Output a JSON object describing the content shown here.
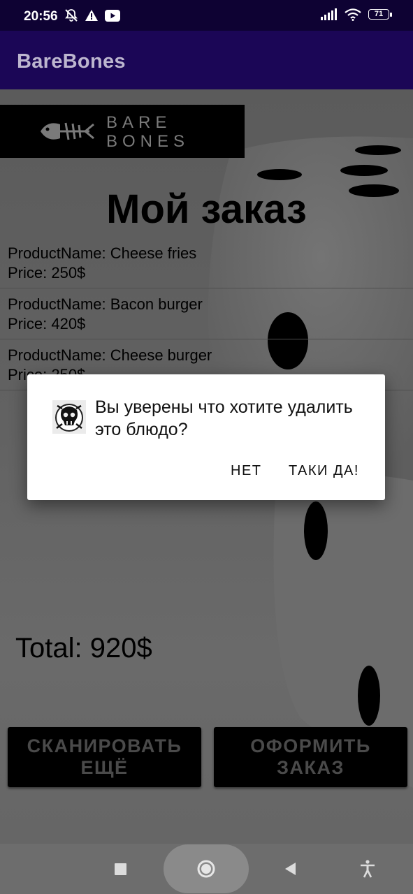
{
  "status_bar": {
    "time": "20:56",
    "battery": "71",
    "icons": [
      "notifications-off-icon",
      "warning-icon",
      "youtube-icon",
      "signal-icon",
      "wifi-icon",
      "battery-icon"
    ]
  },
  "app_bar": {
    "title": "BareBones"
  },
  "logo": {
    "line1": "BARE",
    "line2": "BONES"
  },
  "page": {
    "heading": "Мой заказ",
    "items": [
      {
        "name": "ProductName: Cheese fries",
        "price": "Price: 250$"
      },
      {
        "name": "ProductName: Bacon burger",
        "price": "Price: 420$"
      },
      {
        "name": "ProductName: Cheese burger",
        "price": "Price: 250$"
      }
    ],
    "total": "Total: 920$",
    "scan_button": "СКАНИРОВАТЬ ЕЩЁ",
    "checkout_button": "ОФОРМИТЬ ЗАКАЗ"
  },
  "dialog": {
    "message": "Вы уверены что хотите удалить это блюдо?",
    "negative": "НЕТ",
    "positive": "ТАКИ ДА!"
  },
  "colors": {
    "status_bar": "#0e0233",
    "app_bar": "#1b0656",
    "dim_overlay": "#5b5b5b",
    "dialog_bg": "#ffffff"
  }
}
